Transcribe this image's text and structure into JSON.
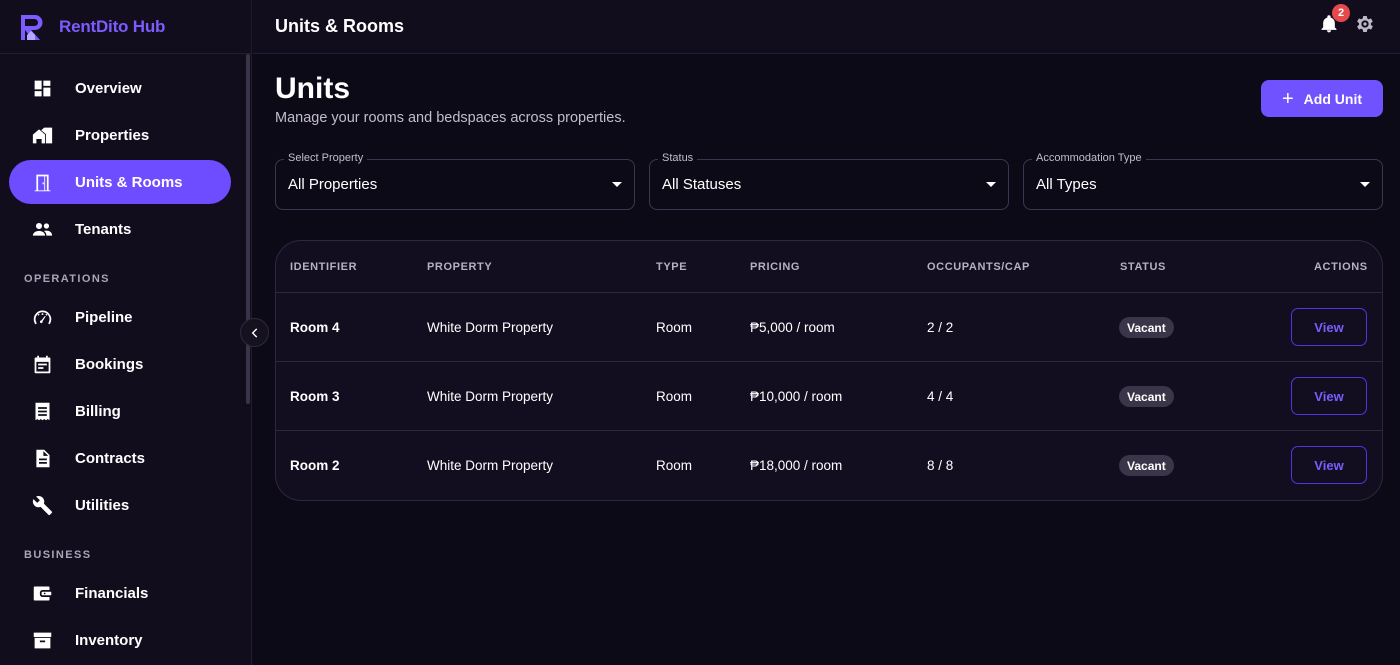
{
  "app": {
    "name": "RentDito Hub",
    "logo": "rentdito-logo-icon"
  },
  "sidebar": {
    "main_items": [
      {
        "label": "Overview",
        "icon": "dashboard-icon",
        "active": false
      },
      {
        "label": "Properties",
        "icon": "properties-icon",
        "active": false
      },
      {
        "label": "Units & Rooms",
        "icon": "door-icon",
        "active": true
      },
      {
        "label": "Tenants",
        "icon": "people-icon",
        "active": false
      }
    ],
    "operations_title": "OPERATIONS",
    "operations_items": [
      {
        "label": "Pipeline",
        "icon": "gauge-icon"
      },
      {
        "label": "Bookings",
        "icon": "calendar-icon"
      },
      {
        "label": "Billing",
        "icon": "receipt-icon"
      },
      {
        "label": "Contracts",
        "icon": "document-icon"
      },
      {
        "label": "Utilities",
        "icon": "wrench-icon"
      }
    ],
    "business_title": "BUSINESS",
    "business_items": [
      {
        "label": "Financials",
        "icon": "wallet-icon"
      },
      {
        "label": "Inventory",
        "icon": "inventory-icon"
      }
    ]
  },
  "topbar": {
    "title": "Units & Rooms",
    "notification_count": "2"
  },
  "page": {
    "title": "Units",
    "subtitle": "Manage your rooms and bedspaces across properties.",
    "add_button": "Add Unit"
  },
  "filters": [
    {
      "label": "Select Property",
      "value": "All Properties"
    },
    {
      "label": "Status",
      "value": "All Statuses"
    },
    {
      "label": "Accommodation Type",
      "value": "All Types"
    }
  ],
  "table": {
    "headers": [
      "IDENTIFIER",
      "PROPERTY",
      "TYPE",
      "PRICING",
      "OCCUPANTS/CAP",
      "STATUS",
      "ACTIONS"
    ],
    "rows": [
      {
        "identifier": "Room 4",
        "property": "White Dorm Property",
        "type": "Room",
        "pricing": "₱5,000 / room",
        "occupancy": "2 / 2",
        "status": "Vacant",
        "action": "View"
      },
      {
        "identifier": "Room 3",
        "property": "White Dorm Property",
        "type": "Room",
        "pricing": "₱10,000 / room",
        "occupancy": "4 / 4",
        "status": "Vacant",
        "action": "View"
      },
      {
        "identifier": "Room 2",
        "property": "White Dorm Property",
        "type": "Room",
        "pricing": "₱18,000 / room",
        "occupancy": "8 / 8",
        "status": "Vacant",
        "action": "View"
      }
    ]
  },
  "colors": {
    "accent": "#7052ff",
    "background": "#0d0a17",
    "sidebar": "#110d1d",
    "badge": "#e5484d"
  }
}
